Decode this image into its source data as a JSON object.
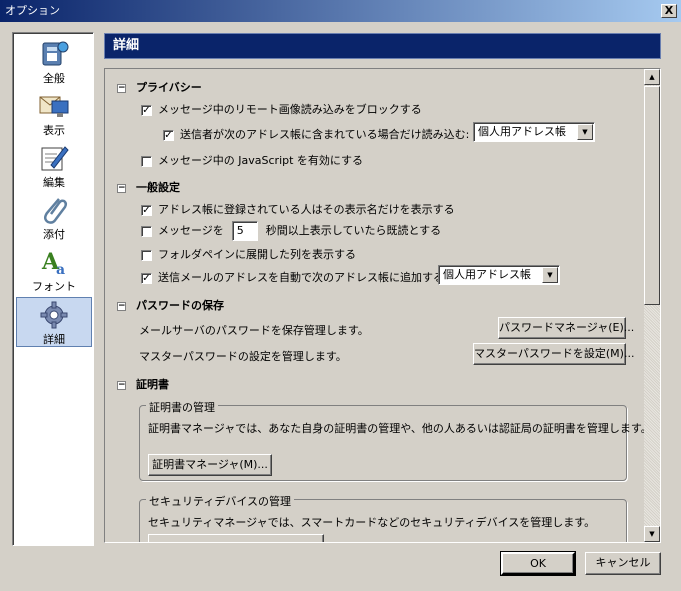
{
  "window": {
    "title": "オプション",
    "close_label": "X"
  },
  "sidebar": {
    "items": [
      {
        "label": "全般",
        "icon": "general-icon"
      },
      {
        "label": "表示",
        "icon": "display-icon"
      },
      {
        "label": "編集",
        "icon": "compose-icon"
      },
      {
        "label": "添付",
        "icon": "attachment-icon"
      },
      {
        "label": "フォント",
        "icon": "font-icon"
      },
      {
        "label": "詳細",
        "icon": "gear-icon",
        "selected": true
      }
    ]
  },
  "header": {
    "title": "詳細"
  },
  "privacy": {
    "title": "プライバシー",
    "block_remote_images": {
      "label": "メッセージ中のリモート画像読み込みをブロックする",
      "checked": true
    },
    "allow_from_addressbook": {
      "label": "送信者が次のアドレス帳に含まれている場合だけ読み込む:",
      "checked": true
    },
    "addressbook_select": "個人用アドレス帳",
    "enable_javascript": {
      "label": "メッセージ中の JavaScript を有効にする",
      "checked": false
    }
  },
  "general": {
    "title": "一般設定",
    "show_display_name": {
      "label": "アドレス帳に登録されている人はその表示名だけを表示する",
      "checked": true
    },
    "mark_read": {
      "label_prefix": "メッセージを",
      "seconds": "5",
      "label_suffix": "秒間以上表示していたら既読とする",
      "checked": false
    },
    "folder_pane_columns": {
      "label": "フォルダペインに展開した列を表示する",
      "checked": false
    },
    "auto_add_outgoing": {
      "label": "送信メールのアドレスを自動で次のアドレス帳に追加する:",
      "checked": true
    },
    "outgoing_select": "個人用アドレス帳"
  },
  "passwords": {
    "title": "パスワードの保存",
    "manage_desc": "メールサーバのパスワードを保存管理します。",
    "manager_button": "パスワードマネージャ(E)...",
    "master_desc": "マスターパスワードの設定を管理します。",
    "master_button": "マスターパスワードを設定(M)..."
  },
  "certificates": {
    "title": "証明書",
    "mgmt_legend": "証明書の管理",
    "mgmt_desc": "証明書マネージャでは、あなた自身の証明書の管理や、他の人あるいは認証局の証明書を管理します。",
    "mgmt_button": "証明書マネージャ(M)...",
    "device_legend": "セキュリティデバイスの管理",
    "device_desc": "セキュリティマネージャでは、スマートカードなどのセキュリティデバイスを管理します。"
  },
  "footer": {
    "ok": "OK",
    "cancel": "キャンセル"
  }
}
